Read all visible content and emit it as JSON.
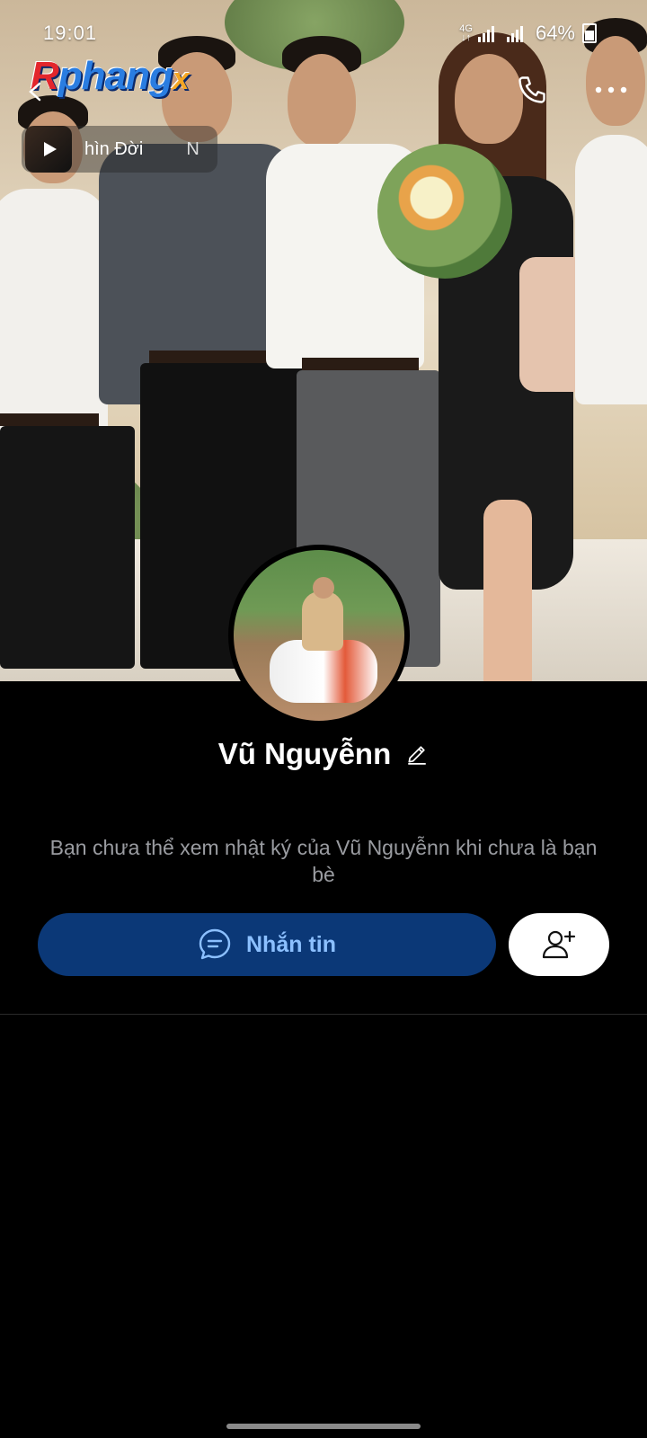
{
  "status_bar": {
    "time": "19:01",
    "network": "4G",
    "battery": "64%"
  },
  "top_bar": {
    "logo": {
      "prefix": "R",
      "main": "phang",
      "suffix": "x"
    }
  },
  "music": {
    "title": "hìn Đời",
    "title_next": "N"
  },
  "profile": {
    "name": "Vũ Nguyễnn",
    "notice": "Bạn chưa thể xem nhật ký của Vũ Nguyễnn khi chưa là bạn bè"
  },
  "actions": {
    "message_label": "Nhắn tin"
  },
  "colors": {
    "message_button_bg": "#0b3877",
    "message_button_text": "#8cc0ff",
    "background": "#000000"
  },
  "icons": {
    "back": "back-arrow-icon",
    "call": "phone-icon",
    "more": "more-dots-icon",
    "play": "play-icon",
    "edit": "pencil-icon",
    "chat": "chat-bubble-icon",
    "add_friend": "add-user-icon"
  }
}
